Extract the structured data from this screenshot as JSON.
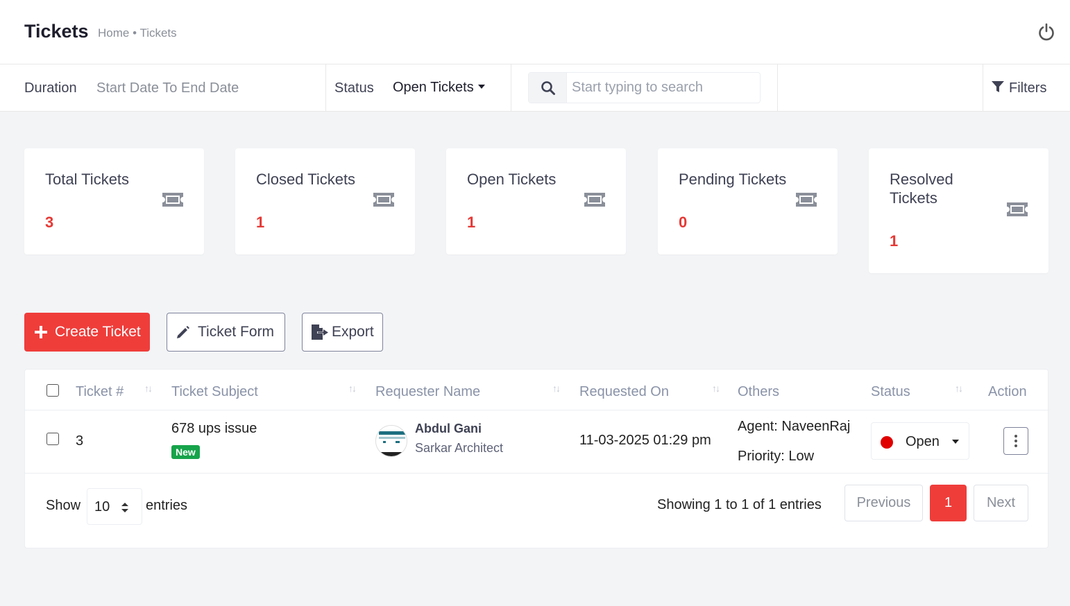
{
  "header": {
    "title": "Tickets",
    "breadcrumb": "Home • Tickets"
  },
  "filterbar": {
    "duration_label": "Duration",
    "duration_value": "Start Date To End Date",
    "status_label": "Status",
    "status_value": "Open Tickets",
    "search_placeholder": "Start typing to search",
    "filters_label": "Filters"
  },
  "stats": [
    {
      "title": "Total Tickets",
      "value": "3"
    },
    {
      "title": "Closed Tickets",
      "value": "1"
    },
    {
      "title": "Open Tickets",
      "value": "1"
    },
    {
      "title": "Pending Tickets",
      "value": "0"
    },
    {
      "title": "Resolved Tickets",
      "value": "1"
    }
  ],
  "actions": {
    "create": "Create Ticket",
    "form": "Ticket Form",
    "export": "Export"
  },
  "table": {
    "columns": [
      "Ticket #",
      "Ticket Subject",
      "Requester Name",
      "Requested On",
      "Others",
      "Status",
      "Action"
    ],
    "rows": [
      {
        "ticket_no": "3",
        "subject": "678 ups issue",
        "badge": "New",
        "requester_name": "Abdul Gani",
        "requester_company": "Sarkar Architect",
        "requested_on": "11-03-2025 01:29 pm",
        "agent": "Agent: NaveenRaj",
        "priority": "Priority: Low",
        "status": "Open"
      }
    ]
  },
  "footer": {
    "show_label": "Show",
    "length_value": "10",
    "entries_label": "entries",
    "info": "Showing 1 to 1 of 1 entries",
    "prev": "Previous",
    "page": "1",
    "next": "Next"
  },
  "colors": {
    "accent": "#ef3d3a",
    "badge_green": "#16a34a",
    "status_dot": "#e00000"
  }
}
